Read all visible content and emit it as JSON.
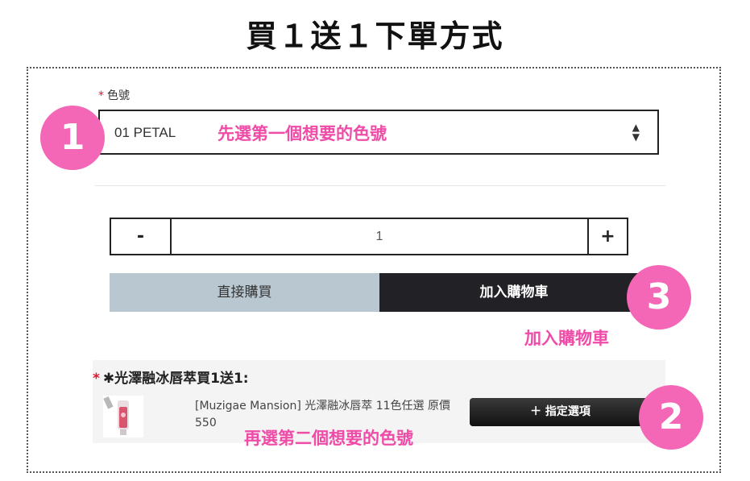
{
  "title": "買１送１下單方式",
  "color_field": {
    "required_mark": "*",
    "label": "色號",
    "selected_value": "01 PETAL",
    "arrows": "▲▼"
  },
  "annotations": {
    "step1_badge": "1",
    "step1_note": "先選第一個想要的色號",
    "step2_badge": "2",
    "step2_note": "再選第二個想要的色號",
    "step3_badge": "3",
    "step3_note": "加入購物車"
  },
  "quantity": {
    "minus_label": "-",
    "value": "1",
    "plus_label": "+"
  },
  "actions": {
    "buy_now_label": "直接購買",
    "add_to_cart_label": "加入購物車"
  },
  "gift": {
    "required_mark": "*",
    "title": "✱光澤融冰唇萃買1送1:",
    "product_name": "[Muzigae Mansion] 光澤融冰唇萃 11色任選 原價550",
    "option_button_label": "＋ 指定選項"
  },
  "colors": {
    "accent_pink": "#ef4ca7",
    "badge_pink": "#f367b6",
    "buy_now_bg": "#b9c7d1",
    "add_cart_bg": "#222226",
    "required_red": "#e0142c"
  }
}
